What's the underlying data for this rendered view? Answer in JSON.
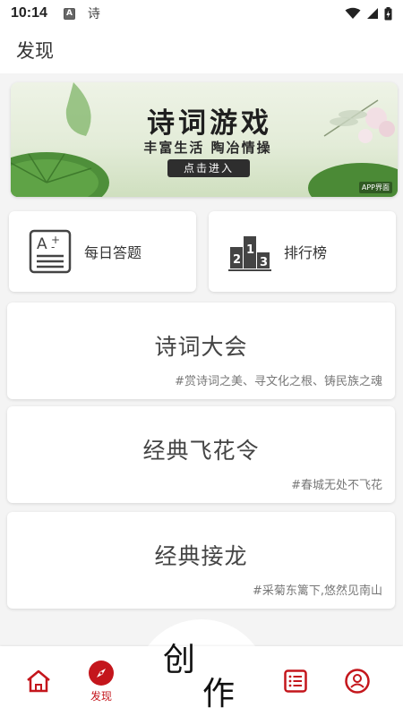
{
  "status_bar": {
    "time": "10:14",
    "notif_letter": "A",
    "notif_text": "诗"
  },
  "header": {
    "title": "发现"
  },
  "banner": {
    "title": "诗词游戏",
    "subtitle": "丰富生活 陶冶情操",
    "button": "点击进入",
    "tag": "APP界面"
  },
  "quick": [
    {
      "label": "每日答题",
      "icon": "quiz-icon"
    },
    {
      "label": "排行榜",
      "icon": "podium-icon"
    }
  ],
  "cards": [
    {
      "title": "诗词大会",
      "tag": "#赏诗词之美、寻文化之根、铸民族之魂"
    },
    {
      "title": "经典飞花令",
      "tag": "#春城无处不飞花"
    },
    {
      "title": "经典接龙",
      "tag": "#采菊东篱下,悠然见南山"
    }
  ],
  "nav": {
    "discover_label": "发现",
    "create_char1": "创",
    "create_char2": "作"
  },
  "colors": {
    "accent": "#c4161c"
  }
}
